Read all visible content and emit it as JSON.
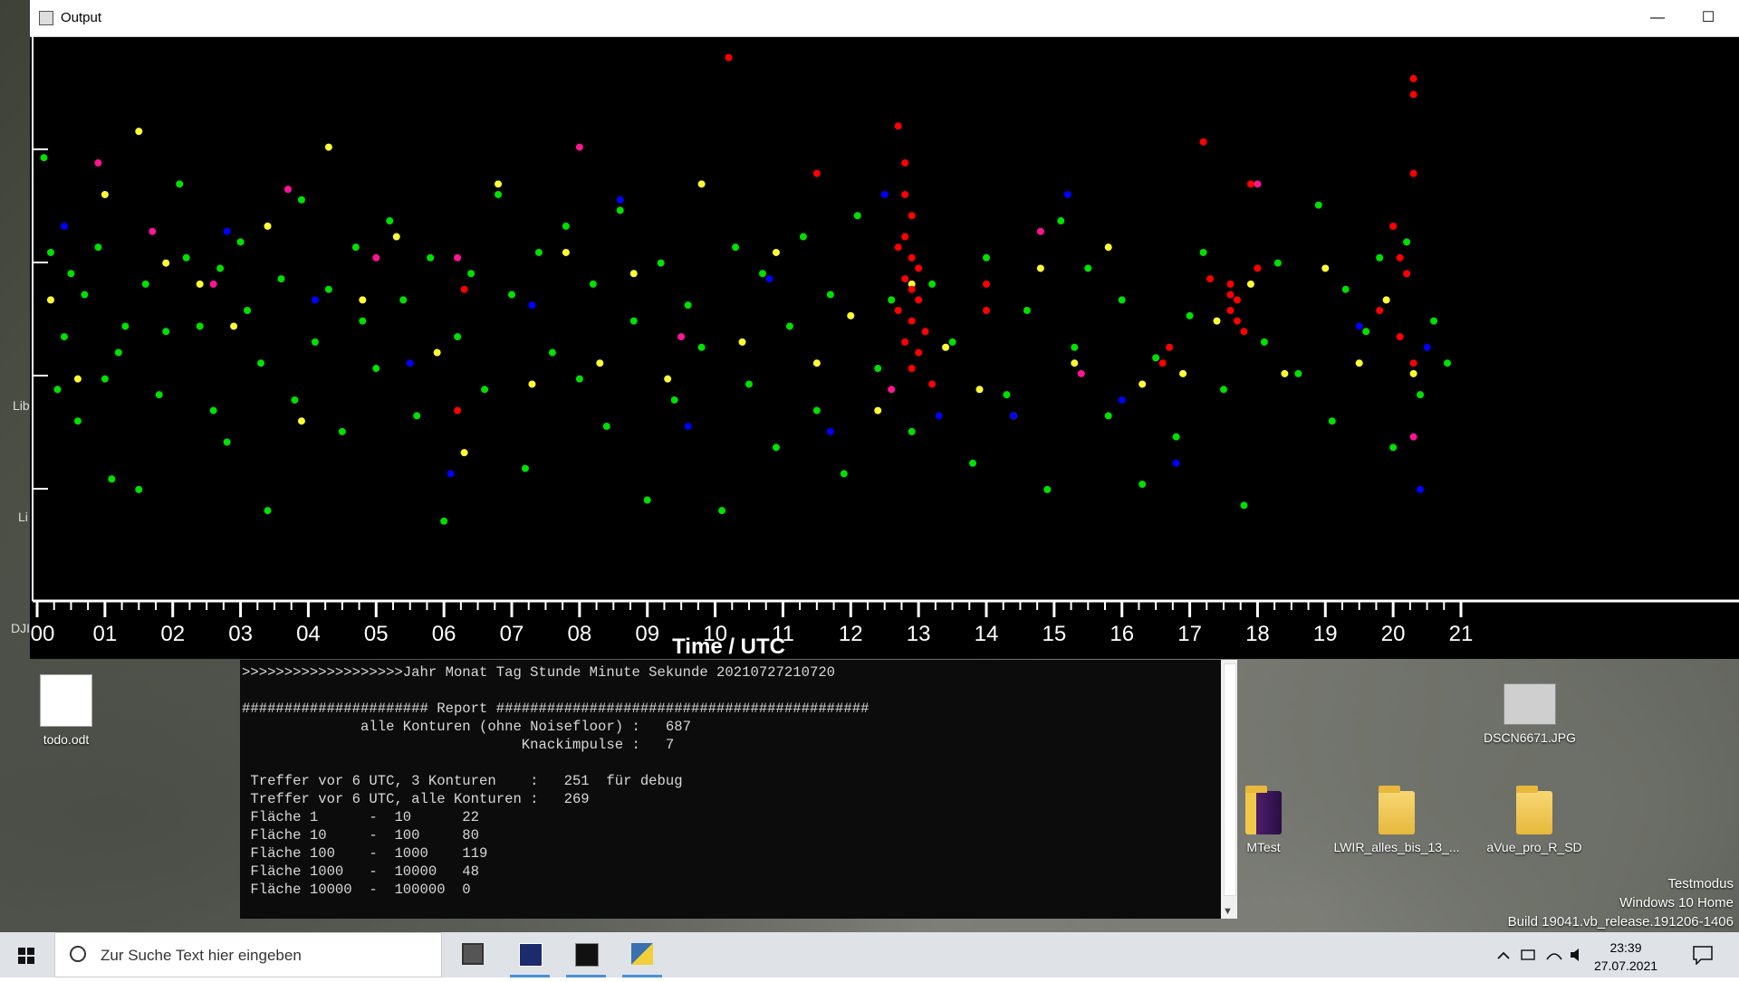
{
  "window": {
    "title": "Output",
    "minimize": "—",
    "maximize": "☐"
  },
  "side_labels": [
    "Lib",
    "Li",
    "DJI"
  ],
  "chart_data": {
    "type": "scatter",
    "xlabel": "Time / UTC",
    "x_ticks": [
      "00",
      "01",
      "02",
      "03",
      "04",
      "05",
      "06",
      "07",
      "08",
      "09",
      "10",
      "11",
      "12",
      "13",
      "14",
      "15",
      "16",
      "17",
      "18",
      "19",
      "20",
      "21"
    ],
    "xlim": [
      0,
      21
    ],
    "ylabel": "",
    "grid": false,
    "colors": {
      "green": "#00e000",
      "yellow": "#ffff33",
      "red": "#ff0000",
      "blue": "#0000ff",
      "magenta": "#ff1493"
    },
    "series": [
      {
        "color": "green",
        "points": [
          [
            0.1,
            0.79
          ],
          [
            0.2,
            0.61
          ],
          [
            0.3,
            0.35
          ],
          [
            0.4,
            0.45
          ],
          [
            0.5,
            0.57
          ],
          [
            0.6,
            0.29
          ],
          [
            0.7,
            0.53
          ],
          [
            0.9,
            0.62
          ],
          [
            1.0,
            0.37
          ],
          [
            1.1,
            0.18
          ],
          [
            1.2,
            0.42
          ],
          [
            1.3,
            0.47
          ],
          [
            1.5,
            0.16
          ],
          [
            1.6,
            0.55
          ],
          [
            1.8,
            0.34
          ],
          [
            1.9,
            0.46
          ],
          [
            2.1,
            0.74
          ],
          [
            2.2,
            0.6
          ],
          [
            2.4,
            0.47
          ],
          [
            2.6,
            0.31
          ],
          [
            2.7,
            0.58
          ],
          [
            2.8,
            0.25
          ],
          [
            3.0,
            0.63
          ],
          [
            3.1,
            0.5
          ],
          [
            3.3,
            0.4
          ],
          [
            3.4,
            0.12
          ],
          [
            3.6,
            0.56
          ],
          [
            3.8,
            0.33
          ],
          [
            3.9,
            0.71
          ],
          [
            4.1,
            0.44
          ],
          [
            4.3,
            0.54
          ],
          [
            4.5,
            0.27
          ],
          [
            4.7,
            0.62
          ],
          [
            4.8,
            0.48
          ],
          [
            5.0,
            0.39
          ],
          [
            5.2,
            0.67
          ],
          [
            5.4,
            0.52
          ],
          [
            5.6,
            0.3
          ],
          [
            5.8,
            0.6
          ],
          [
            6.0,
            0.1
          ],
          [
            6.2,
            0.45
          ],
          [
            6.4,
            0.57
          ],
          [
            6.6,
            0.35
          ],
          [
            6.8,
            0.72
          ],
          [
            7.0,
            0.53
          ],
          [
            7.2,
            0.2
          ],
          [
            7.4,
            0.61
          ],
          [
            7.6,
            0.42
          ],
          [
            7.8,
            0.66
          ],
          [
            8.0,
            0.37
          ],
          [
            8.2,
            0.55
          ],
          [
            8.4,
            0.28
          ],
          [
            8.6,
            0.69
          ],
          [
            8.8,
            0.48
          ],
          [
            9.0,
            0.14
          ],
          [
            9.2,
            0.59
          ],
          [
            9.4,
            0.33
          ],
          [
            9.6,
            0.51
          ],
          [
            9.8,
            0.43
          ],
          [
            10.1,
            0.12
          ],
          [
            10.3,
            0.62
          ],
          [
            10.5,
            0.36
          ],
          [
            10.7,
            0.57
          ],
          [
            10.9,
            0.24
          ],
          [
            11.1,
            0.47
          ],
          [
            11.3,
            0.64
          ],
          [
            11.5,
            0.31
          ],
          [
            11.7,
            0.53
          ],
          [
            11.9,
            0.19
          ],
          [
            12.1,
            0.68
          ],
          [
            12.4,
            0.39
          ],
          [
            12.6,
            0.52
          ],
          [
            12.9,
            0.27
          ],
          [
            13.2,
            0.55
          ],
          [
            13.5,
            0.44
          ],
          [
            13.8,
            0.21
          ],
          [
            14.0,
            0.6
          ],
          [
            14.3,
            0.34
          ],
          [
            14.6,
            0.5
          ],
          [
            14.9,
            0.16
          ],
          [
            15.1,
            0.67
          ],
          [
            15.3,
            0.43
          ],
          [
            15.5,
            0.58
          ],
          [
            15.8,
            0.3
          ],
          [
            16.0,
            0.52
          ],
          [
            16.3,
            0.17
          ],
          [
            16.5,
            0.41
          ],
          [
            16.8,
            0.26
          ],
          [
            17.0,
            0.49
          ],
          [
            17.2,
            0.61
          ],
          [
            17.5,
            0.35
          ],
          [
            17.8,
            0.13
          ],
          [
            18.1,
            0.44
          ],
          [
            18.3,
            0.59
          ],
          [
            18.6,
            0.38
          ],
          [
            18.9,
            0.7
          ],
          [
            19.1,
            0.29
          ],
          [
            19.3,
            0.54
          ],
          [
            19.6,
            0.46
          ],
          [
            19.8,
            0.6
          ],
          [
            20.0,
            0.24
          ],
          [
            20.2,
            0.63
          ],
          [
            20.4,
            0.34
          ],
          [
            20.6,
            0.48
          ],
          [
            20.8,
            0.4
          ]
        ]
      },
      {
        "color": "yellow",
        "points": [
          [
            0.2,
            0.52
          ],
          [
            0.6,
            0.37
          ],
          [
            1.0,
            0.72
          ],
          [
            1.5,
            0.84
          ],
          [
            1.9,
            0.59
          ],
          [
            2.4,
            0.55
          ],
          [
            2.9,
            0.47
          ],
          [
            3.4,
            0.66
          ],
          [
            3.9,
            0.29
          ],
          [
            4.3,
            0.81
          ],
          [
            4.8,
            0.52
          ],
          [
            5.3,
            0.64
          ],
          [
            5.9,
            0.42
          ],
          [
            6.3,
            0.23
          ],
          [
            6.8,
            0.74
          ],
          [
            7.3,
            0.36
          ],
          [
            7.8,
            0.61
          ],
          [
            8.3,
            0.4
          ],
          [
            8.8,
            0.57
          ],
          [
            9.3,
            0.37
          ],
          [
            9.8,
            0.74
          ],
          [
            10.4,
            0.44
          ],
          [
            10.9,
            0.61
          ],
          [
            11.5,
            0.4
          ],
          [
            12.0,
            0.49
          ],
          [
            12.4,
            0.31
          ],
          [
            12.9,
            0.55
          ],
          [
            13.4,
            0.43
          ],
          [
            13.9,
            0.35
          ],
          [
            14.4,
            0.3
          ],
          [
            14.8,
            0.58
          ],
          [
            15.3,
            0.4
          ],
          [
            15.8,
            0.62
          ],
          [
            16.3,
            0.36
          ],
          [
            16.9,
            0.38
          ],
          [
            17.4,
            0.48
          ],
          [
            17.9,
            0.55
          ],
          [
            18.4,
            0.38
          ],
          [
            19.0,
            0.58
          ],
          [
            19.5,
            0.4
          ],
          [
            19.9,
            0.52
          ],
          [
            20.3,
            0.38
          ]
        ]
      },
      {
        "color": "red",
        "points": [
          [
            10.2,
            0.98
          ],
          [
            12.7,
            0.85
          ],
          [
            12.8,
            0.78
          ],
          [
            12.8,
            0.72
          ],
          [
            12.9,
            0.68
          ],
          [
            12.8,
            0.64
          ],
          [
            12.7,
            0.62
          ],
          [
            12.9,
            0.6
          ],
          [
            13.0,
            0.58
          ],
          [
            12.8,
            0.56
          ],
          [
            12.9,
            0.54
          ],
          [
            13.0,
            0.52
          ],
          [
            12.7,
            0.5
          ],
          [
            12.9,
            0.48
          ],
          [
            13.1,
            0.46
          ],
          [
            12.8,
            0.44
          ],
          [
            13.0,
            0.42
          ],
          [
            12.9,
            0.39
          ],
          [
            13.2,
            0.36
          ],
          [
            11.5,
            0.76
          ],
          [
            14.0,
            0.55
          ],
          [
            14.0,
            0.5
          ],
          [
            6.3,
            0.54
          ],
          [
            6.2,
            0.31
          ],
          [
            16.7,
            0.43
          ],
          [
            16.6,
            0.4
          ],
          [
            17.2,
            0.82
          ],
          [
            17.3,
            0.56
          ],
          [
            17.6,
            0.55
          ],
          [
            17.7,
            0.52
          ],
          [
            17.6,
            0.5
          ],
          [
            17.7,
            0.48
          ],
          [
            17.8,
            0.46
          ],
          [
            17.6,
            0.53
          ],
          [
            17.9,
            0.74
          ],
          [
            18.0,
            0.58
          ],
          [
            20.0,
            0.66
          ],
          [
            20.1,
            0.6
          ],
          [
            20.2,
            0.57
          ],
          [
            20.3,
            0.94
          ],
          [
            20.3,
            0.91
          ],
          [
            20.3,
            0.76
          ],
          [
            20.1,
            0.45
          ],
          [
            20.3,
            0.4
          ],
          [
            19.8,
            0.5
          ]
        ]
      },
      {
        "color": "blue",
        "points": [
          [
            0.4,
            0.66
          ],
          [
            2.8,
            0.65
          ],
          [
            4.1,
            0.52
          ],
          [
            5.5,
            0.4
          ],
          [
            6.1,
            0.19
          ],
          [
            7.3,
            0.51
          ],
          [
            8.6,
            0.71
          ],
          [
            9.6,
            0.28
          ],
          [
            10.8,
            0.56
          ],
          [
            11.7,
            0.27
          ],
          [
            12.5,
            0.72
          ],
          [
            13.3,
            0.3
          ],
          [
            14.4,
            0.3
          ],
          [
            15.2,
            0.72
          ],
          [
            16.0,
            0.33
          ],
          [
            16.8,
            0.21
          ],
          [
            19.5,
            0.47
          ],
          [
            20.4,
            0.16
          ],
          [
            20.5,
            0.43
          ]
        ]
      },
      {
        "color": "magenta",
        "points": [
          [
            0.9,
            0.78
          ],
          [
            1.7,
            0.65
          ],
          [
            2.6,
            0.55
          ],
          [
            3.7,
            0.73
          ],
          [
            5.0,
            0.6
          ],
          [
            6.2,
            0.6
          ],
          [
            8.0,
            0.81
          ],
          [
            9.5,
            0.45
          ],
          [
            12.6,
            0.35
          ],
          [
            14.8,
            0.65
          ],
          [
            15.4,
            0.38
          ],
          [
            18.0,
            0.74
          ],
          [
            20.3,
            0.26
          ]
        ]
      }
    ]
  },
  "console": {
    "lines": [
      ">>>>>>>>>>>>>>>>>>>Jahr Monat Tag Stunde Minute Sekunde 20210727210720",
      "",
      "###################### Report ############################################",
      "              alle Konturen (ohne Noisefloor) :   687",
      "                                 Knackimpulse :   7",
      "",
      " Treffer vor 6 UTC, 3 Konturen    :   251  für debug",
      " Treffer vor 6 UTC, alle Konturen :   269",
      " Fläche 1      -  10      22",
      " Fläche 10     -  100     80",
      " Fläche 100    -  1000    119",
      " Fläche 1000   -  10000   48",
      " Fläche 10000  -  100000  0"
    ]
  },
  "desktop_icons": [
    {
      "label": "todo.odt",
      "kind": "doc"
    },
    {
      "label": "DSCN6671.JPG",
      "kind": "image"
    },
    {
      "label": "MTest",
      "kind": "folder"
    },
    {
      "label": "LWIR_alles_bis_13_...",
      "kind": "folder"
    },
    {
      "label": "aVue_pro_R_SD",
      "kind": "folder"
    }
  ],
  "watermark": [
    "Testmodus",
    "Windows 10 Home",
    "Build 19041.vb_release.191206-1406"
  ],
  "taskbar": {
    "search_placeholder": "Zur Suche Text hier eingeben",
    "time": "23:39",
    "date": "27.07.2021"
  }
}
